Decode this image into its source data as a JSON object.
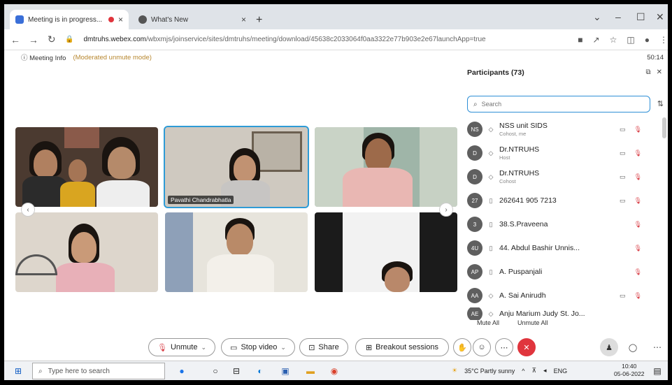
{
  "browser": {
    "tabs": [
      {
        "label": "Meeting is in progress..."
      },
      {
        "label": "What's New"
      }
    ],
    "url_domain": "dmtruhs.webex.com",
    "url_path": "/wbxmjs/joinservice/sites/dmtruhs/meeting/download/45638c2033064f0aa3322e77b903e2e67launchApp=true"
  },
  "meeting": {
    "info_label": "Meeting Info",
    "mode_label": "(Moderated unmute mode)",
    "timer": "50:14"
  },
  "video_tiles": [
    {
      "name": ""
    },
    {
      "name": "Pavathi Chandrabhatla"
    },
    {
      "name": ""
    },
    {
      "name": ""
    },
    {
      "name": ""
    },
    {
      "name": ""
    }
  ],
  "participants_panel": {
    "title": "Participants (73)",
    "search_placeholder": "Search",
    "participants": [
      {
        "initials": "NS",
        "name": "NSS unit SIDS",
        "sub": "Cohost, me"
      },
      {
        "initials": "D",
        "name": "Dr.NTRUHS",
        "sub": "Host"
      },
      {
        "initials": "D",
        "name": "Dr.NTRUHS",
        "sub": "Cohost"
      },
      {
        "initials": "27",
        "name": "262641 905 7213",
        "sub": ""
      },
      {
        "initials": "3",
        "name": "38.S.Praveena",
        "sub": ""
      },
      {
        "initials": "4U",
        "name": "44. Abdul Bashir Unnis...",
        "sub": ""
      },
      {
        "initials": "AP",
        "name": "A. Puspanjali",
        "sub": ""
      },
      {
        "initials": "AA",
        "name": "A. Sai Anirudh",
        "sub": ""
      },
      {
        "initials": "AE",
        "name": "Anju Marium Judy St. Jo...",
        "sub": ""
      }
    ],
    "mute_all": "Mute All",
    "unmute_all": "Unmute All"
  },
  "controls": {
    "unmute": "Unmute",
    "stop_video": "Stop video",
    "share": "Share",
    "breakout": "Breakout sessions"
  },
  "taskbar": {
    "search_placeholder": "Type here to search",
    "weather": "35°C  Partly sunny",
    "lang": "ENG",
    "time": "10:40",
    "date": "05-06-2022"
  }
}
